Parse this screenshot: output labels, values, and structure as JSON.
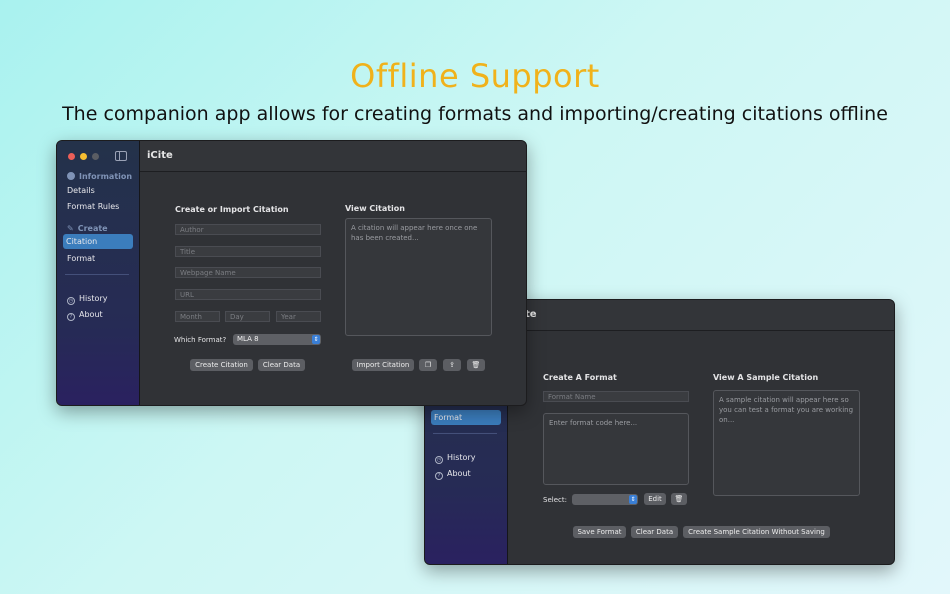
{
  "hero": {
    "title": "Offline Support",
    "subtitle": "The companion app allows for creating formats and importing/creating citations offline"
  },
  "window1": {
    "title": "iCite",
    "sidebar": {
      "info_header": "Information",
      "details": "Details",
      "format_rules": "Format Rules",
      "create_header": "Create",
      "citation": "Citation",
      "format": "Format",
      "history": "History",
      "about": "About"
    },
    "form": {
      "heading": "Create or Import Citation",
      "author_placeholder": "Author",
      "title_placeholder": "Title",
      "webpage_placeholder": "Webpage Name",
      "url_placeholder": "URL",
      "month_placeholder": "Month",
      "day_placeholder": "Day",
      "year_placeholder": "Year",
      "which_format_label": "Which Format?",
      "format_value": "MLA 8",
      "create_button": "Create Citation",
      "clear_button": "Clear Data"
    },
    "view": {
      "heading": "View Citation",
      "placeholder": "A citation will appear here once one has been created...",
      "import_button": "Import Citation"
    }
  },
  "window2": {
    "title_fragment": "te",
    "sidebar": {
      "format": "Format",
      "history": "History",
      "about": "About"
    },
    "form": {
      "heading": "Create A Format",
      "name_placeholder": "Format Name",
      "code_placeholder": "Enter format code here...",
      "select_label": "Select:",
      "edit_button": "Edit",
      "save_button": "Save Format",
      "clear_button": "Clear Data",
      "sample_button": "Create Sample Citation Without Saving"
    },
    "sample": {
      "heading": "View A Sample Citation",
      "placeholder": "A sample citation will appear here so you can test a format you are working on..."
    }
  },
  "colors": {
    "accent": "#f0b21b",
    "selection": "#3b7dbd",
    "window_bg": "#303236"
  }
}
